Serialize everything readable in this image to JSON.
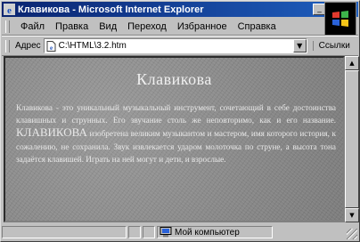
{
  "window": {
    "title": "Клавикова - Microsoft Internet Explorer"
  },
  "menu": {
    "items": [
      {
        "label": "Файл"
      },
      {
        "label": "Правка"
      },
      {
        "label": "Вид"
      },
      {
        "label": "Переход"
      },
      {
        "label": "Избранное"
      },
      {
        "label": "Справка"
      }
    ]
  },
  "address": {
    "label": "Адрес",
    "value": "C:\\HTML\\3.2.htm",
    "links_label": "Ссылки"
  },
  "page": {
    "heading": "Клавикова",
    "text_1": "Клавикова - это уникальный музыкальный инструмент, сочетающий в себе достоинства клавишных и струнных. Его звучание столь же неповторимо, как и его название. ",
    "text_big": "КЛАВИКОВА",
    "text_2": " изобретена великим музыкантом и мастером, имя которого история, к сожалению, не сохранила. Звук извлекается ударом молоточка по струне, а высота тона задаётся клавишей. Играть на ней могут и дети, и взрослые."
  },
  "status": {
    "zone_label": "Мой компьютер"
  },
  "colors": {
    "titlebar_start": "#0a2470",
    "titlebar_end": "#1f5fbf",
    "chrome": "#c0c0c0",
    "page_background": "#8c8c8c"
  }
}
